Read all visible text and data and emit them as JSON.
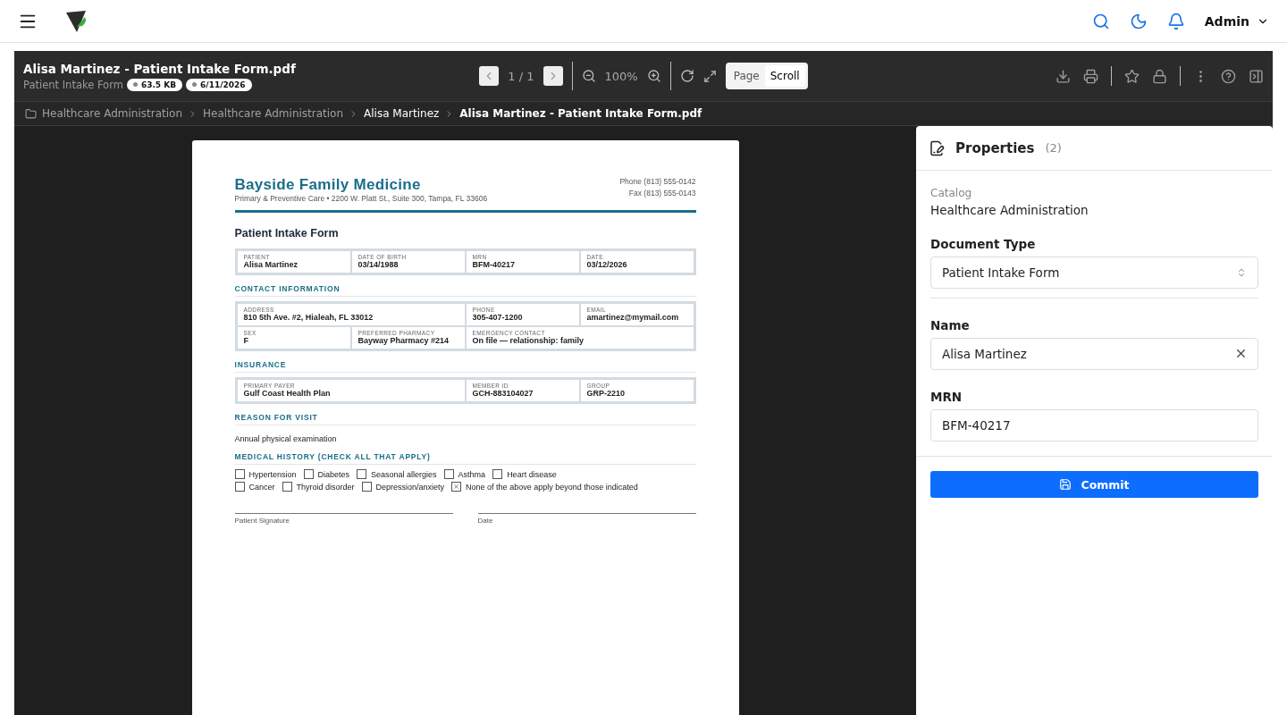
{
  "nav": {
    "user": "Admin"
  },
  "viewer": {
    "title": "Alisa Martinez - Patient Intake Form.pdf",
    "subtitle": "Patient Intake Form",
    "badges": [
      "63.5 KB",
      "6/11/2026"
    ],
    "page_indicator": "1 / 1",
    "zoom": "100%",
    "view_modes": [
      {
        "label": "Page",
        "selected": false
      },
      {
        "label": "Scroll",
        "selected": true
      }
    ]
  },
  "breadcrumb": [
    {
      "label": "Healthcare Administration",
      "current": false
    },
    {
      "label": "Healthcare Administration",
      "current": false
    },
    {
      "label": "Alisa Martinez",
      "current": true
    },
    {
      "label": "Alisa Martinez - Patient Intake Form.pdf",
      "current": true
    }
  ],
  "document": {
    "clinic_name": "Bayside Family Medicine",
    "clinic_address": "Primary & Preventive Care • 2200 W. Platt St., Suite 300, Tampa, FL 33606",
    "phone": "Phone (813) 555-0142",
    "fax": "Fax (813) 555-0143",
    "form_title": "Patient Intake Form",
    "sections": [
      {
        "kind": "grid",
        "cells": [
          {
            "label": "PATIENT",
            "value": "Alisa Martinez",
            "wide": false
          },
          {
            "label": "DATE OF BIRTH",
            "value": "03/14/1988",
            "wide": false
          },
          {
            "label": "MRN",
            "value": "BFM-40217",
            "wide": false
          },
          {
            "label": "DATE",
            "value": "03/12/2026",
            "wide": false
          }
        ]
      },
      {
        "kind": "grid",
        "heading": "CONTACT INFORMATION",
        "cells": [
          {
            "label": "ADDRESS",
            "value": "810 5th Ave. #2, Hialeah, FL 33012",
            "wide": true
          },
          {
            "label": "PHONE",
            "value": "305-407-1200",
            "wide": false
          },
          {
            "label": "EMAIL",
            "value": "amartinez@mymail.com",
            "wide": false
          },
          {
            "label": "SEX",
            "value": "F",
            "wide": false
          },
          {
            "label": "PREFERRED PHARMACY",
            "value": "Bayway Pharmacy #214",
            "wide": false
          },
          {
            "label": "EMERGENCY CONTACT",
            "value": "On file — relationship: family",
            "wide": true
          }
        ]
      },
      {
        "kind": "grid",
        "heading": "INSURANCE",
        "cells": [
          {
            "label": "PRIMARY PAYER",
            "value": "Gulf Coast Health Plan",
            "wide": true
          },
          {
            "label": "MEMBER ID",
            "value": "GCH-883104027",
            "wide": false
          },
          {
            "label": "GROUP",
            "value": "GRP-2210",
            "wide": false
          }
        ]
      },
      {
        "kind": "text",
        "heading": "REASON FOR VISIT",
        "text": "Annual physical examination"
      },
      {
        "kind": "checklist",
        "heading": "MEDICAL HISTORY (CHECK ALL THAT APPLY)",
        "rows": [
          {
            "items": [
              {
                "label": "Hypertension",
                "checked": false
              },
              {
                "label": "Diabetes",
                "checked": false
              },
              {
                "label": "Seasonal allergies",
                "checked": false
              },
              {
                "label": "Asthma",
                "checked": false
              },
              {
                "label": "Heart disease",
                "checked": false
              }
            ]
          },
          {
            "items": [
              {
                "label": "Cancer",
                "checked": false
              },
              {
                "label": "Thyroid disorder",
                "checked": false
              },
              {
                "label": "Depression/anxiety",
                "checked": false
              },
              {
                "label": "None of the above apply beyond those indicated",
                "checked": true
              }
            ]
          }
        ]
      }
    ],
    "signature_labels": [
      "Patient Signature",
      "Date"
    ]
  },
  "properties": {
    "title": "Properties",
    "count": "(2)",
    "catalog_label": "Catalog",
    "catalog_value": "Healthcare Administration",
    "fields": [
      {
        "kind": "select",
        "label": "Document Type",
        "value": "Patient Intake Form"
      },
      {
        "kind": "text",
        "label": "Name",
        "value": "Alisa Martinez",
        "clearable": true
      },
      {
        "kind": "text",
        "label": "MRN",
        "value": "BFM-40217",
        "clearable": false
      }
    ],
    "commit": "Commit"
  }
}
